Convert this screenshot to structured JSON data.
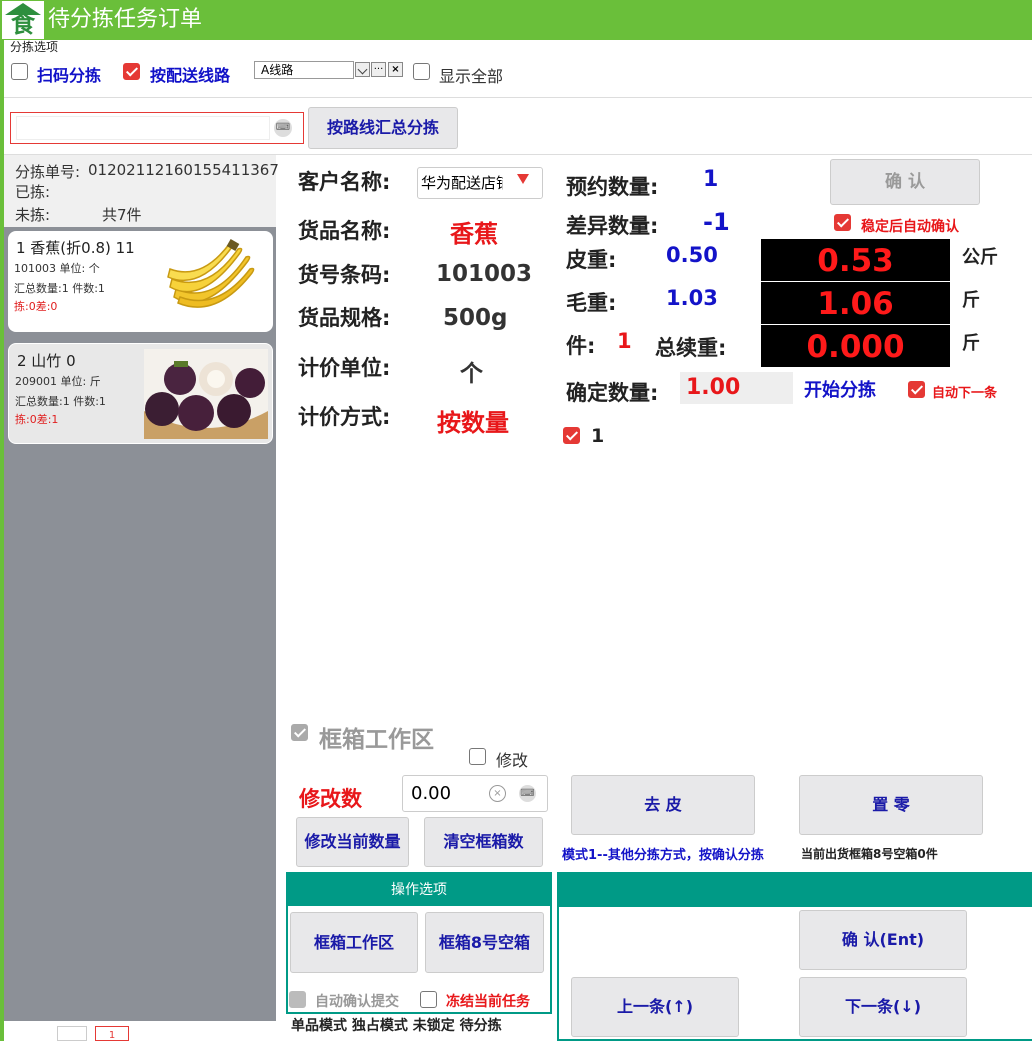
{
  "window": {
    "title": "待分拣任务订单",
    "logo_char": "食"
  },
  "options": {
    "legend": "分拣选项",
    "scan_sort": "扫码分拣",
    "by_route": "按配送线路",
    "route_value": "A线路",
    "route_more": "···",
    "route_clear": "×",
    "show_all": "显示全部"
  },
  "search": {
    "placeholder": "",
    "button": "按路线汇总分拣"
  },
  "left": {
    "order_no_label": "分拣单号:",
    "order_no": "01202112160155411367",
    "picked_label": "已拣:",
    "unpicked_label": "未拣:",
    "total": "共7件",
    "items": [
      {
        "title": "1 香蕉(折0.8) 11",
        "code_unit": "101003 单位: 个",
        "summary": "汇总数量:1 件数:1",
        "status": "拣:0差:0"
      },
      {
        "title": "2 山竹 0",
        "code_unit": "209001 单位: 斤",
        "summary": "汇总数量:1 件数:1",
        "status": "拣:0差:1"
      }
    ],
    "pager_current": "1"
  },
  "detail": {
    "customer_label": "客户名称:",
    "customer_value": "华为配送店铺",
    "goods_name_label": "货品名称:",
    "goods_name": "香蕉",
    "barcode_label": "货号条码:",
    "barcode": "101003",
    "spec_label": "货品规格:",
    "spec": "500g",
    "price_unit_label": "计价单位:",
    "price_unit": "个",
    "price_method_label": "计价方式:",
    "price_method": "按数量"
  },
  "weights": {
    "reserve_label": "预约数量:",
    "reserve": "1",
    "diff_label": "差异数量:",
    "diff": "-1",
    "confirm_button": "确 认",
    "auto_confirm": "稳定后自动确认",
    "tare_label": "皮重:",
    "tare": "0.50",
    "tare_lcd": "0.53",
    "tare_unit": "公斤",
    "gross_label": "毛重:",
    "gross": "1.03",
    "gross_lcd": "1.06",
    "gross_unit": "斤",
    "piece_label": "件:",
    "piece": "1",
    "total_weight_label": "总续重:",
    "total_lcd": "0.000",
    "total_unit": "斤",
    "confirm_qty_label": "确定数量:",
    "confirm_qty": "1.00",
    "start_sort": "开始分拣",
    "auto_next": "自动下一条",
    "check_one": "1"
  },
  "box": {
    "title": "框箱工作区",
    "modify_check": "修改",
    "modify_num_label": "修改数",
    "modify_value": "0.00",
    "btn_modify_current": "修改当前数量",
    "btn_clear_box": "清空框箱数",
    "btn_tare": "去 皮",
    "btn_zero": "置 零",
    "mode_note": "模式1--其他分拣方式，按确认分拣",
    "box_note": "当前出货框箱8号空箱0件"
  },
  "ops": {
    "header": "操作选项",
    "btn_box_area": "框箱工作区",
    "btn_box8": "框箱8号空箱",
    "auto_submit": "自动确认提交",
    "freeze_task": "冻结当前任务",
    "status_bar": "单品模式 独占模式 未锁定 待分拣"
  },
  "nav": {
    "confirm_ent": "确 认(Ent)",
    "prev": "上一条(↑)",
    "next": "下一条(↓)"
  },
  "colors": {
    "title_bar": "#6abf3a",
    "teal": "#009a86",
    "red": "#e8171a",
    "blue": "#1313c8"
  }
}
